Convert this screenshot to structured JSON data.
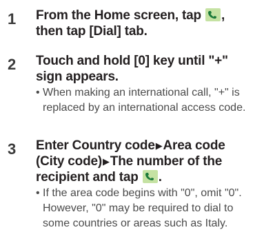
{
  "icons": {
    "phone": "phone-icon",
    "arrow": "right-triangle-arrow"
  },
  "colors": {
    "icon_bg": "#c5e2a3",
    "icon_handset": "#1b7a3a"
  },
  "steps": [
    {
      "number": "1",
      "text_a": "From the Home screen, tap ",
      "text_b": ",",
      "text_c": "then tap [Dial] tab."
    },
    {
      "number": "2",
      "text_a": "Touch and hold [0] key until \"+\"",
      "text_b": "sign appears.",
      "note_bullet": "•",
      "note": "When making an international call, \"+\" is replaced by an international access code."
    },
    {
      "number": "3",
      "text_a": "Enter Country code",
      "arrow1": "▶",
      "text_b": "Area code",
      "text_c": "(City code)",
      "arrow2": "▶",
      "text_d": "The number of the",
      "text_e": "recipient and tap ",
      "text_f": ".",
      "note_bullet": "•",
      "note": "If the area code begins with \"0\", omit \"0\". However, \"0\" may be required to dial to some countries or areas such as Italy."
    }
  ]
}
